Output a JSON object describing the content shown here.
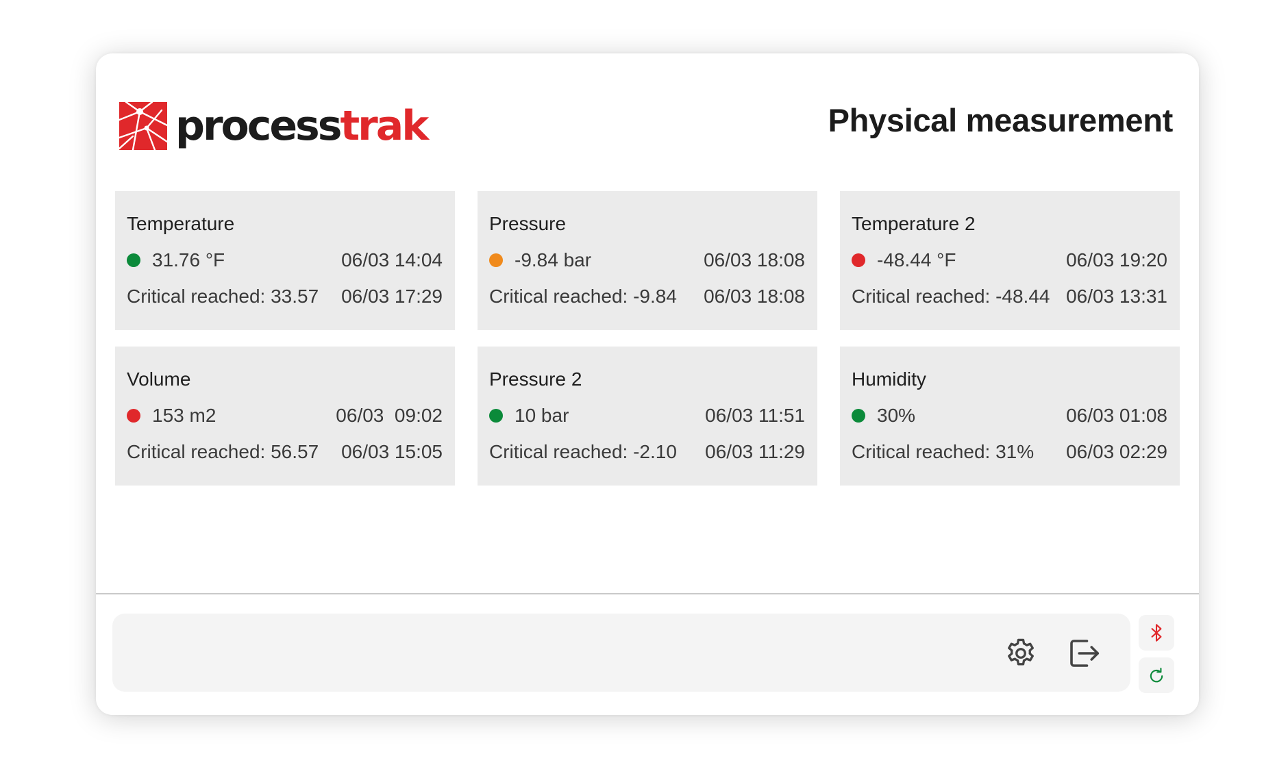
{
  "brand": {
    "part1": "process",
    "part2": "trak"
  },
  "page_title": "Physical measurement",
  "status_colors": {
    "ok": "#0b8a3a",
    "warning": "#f08a1c",
    "critical": "#e0282b"
  },
  "cards": [
    {
      "title": "Temperature",
      "status": "ok",
      "value": "31.76 °F",
      "time": "06/03 14:04",
      "critical": "Critical reached: 33.57",
      "critical_time": "06/03 17:29"
    },
    {
      "title": "Pressure",
      "status": "warning",
      "value": "-9.84 bar",
      "time": "06/03 18:08",
      "critical": "Critical reached: -9.84",
      "critical_time": "06/03 18:08"
    },
    {
      "title": "Temperature 2",
      "status": "critical",
      "value": "-48.44 °F",
      "time": "06/03 19:20",
      "critical": "Critical reached: -48.44",
      "critical_time": "06/03 13:31"
    },
    {
      "title": "Volume",
      "status": "critical",
      "value": "153 m2",
      "time": "06/03  09:02",
      "critical": "Critical reached: 56.57",
      "critical_time": "06/03 15:05"
    },
    {
      "title": "Pressure 2",
      "status": "ok",
      "value": "10 bar",
      "time": "06/03 11:51",
      "critical": "Critical reached: -2.10",
      "critical_time": "06/03 11:29"
    },
    {
      "title": "Humidity",
      "status": "ok",
      "value": "30%",
      "time": "06/03 01:08",
      "critical": "Critical reached: 31%",
      "critical_time": "06/03 02:29"
    }
  ],
  "toolbar": {
    "settings_icon": "gear-icon",
    "logout_icon": "logout-icon",
    "bluetooth_icon": "bluetooth-icon",
    "refresh_icon": "refresh-icon"
  }
}
